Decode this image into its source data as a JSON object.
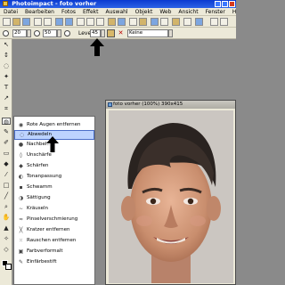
{
  "window": {
    "title": "Photoimpact - foto vorher",
    "controls": [
      "minimize-icon",
      "maximize-icon",
      "close-icon"
    ]
  },
  "menubar": {
    "items": [
      "Datei",
      "Bearbeiten",
      "Fotos",
      "Effekt",
      "Auswahl",
      "Objekt",
      "Web",
      "Ansicht",
      "Fenster",
      "Hilfe"
    ]
  },
  "options_bar": {
    "field1": "20",
    "field2": "50",
    "level_label": "Level",
    "level_value": "45",
    "mode_value": "Keine"
  },
  "flyout": {
    "items": [
      {
        "label": "Rote Augen entfernen",
        "icon": "eye-icon",
        "selected": false
      },
      {
        "label": "Abwedeln",
        "icon": "dodge-icon",
        "selected": true
      },
      {
        "label": "Nachbel...",
        "icon": "burn-icon",
        "selected": false
      },
      {
        "label": "Unschärfe",
        "icon": "blur-icon",
        "selected": false
      },
      {
        "label": "Schärfen",
        "icon": "sharpen-icon",
        "selected": false
      },
      {
        "label": "Tonanpassung",
        "icon": "tone-icon",
        "selected": false
      },
      {
        "label": "Schwamm",
        "icon": "sponge-icon",
        "selected": false
      },
      {
        "label": "Sättigung",
        "icon": "saturation-icon",
        "selected": false
      },
      {
        "label": "Kräuseln",
        "icon": "smudge-icon",
        "selected": false
      },
      {
        "label": "Pinselverschmierung",
        "icon": "brush-smear-icon",
        "selected": false
      },
      {
        "label": "Kratzer entfernen",
        "icon": "scratch-icon",
        "selected": false
      },
      {
        "label": "Rauschen entfernen",
        "icon": "noise-icon",
        "selected": false
      },
      {
        "label": "Farbverformalt",
        "icon": "color-icon",
        "selected": false
      },
      {
        "label": "Einfärbestift",
        "icon": "colorize-icon",
        "selected": false
      }
    ]
  },
  "image_window": {
    "title": "foto vorher (100%) 390x415"
  },
  "colors": {
    "title_bar": "#0a3ad0",
    "menu_bg": "#ece9d8",
    "selection": "#bcd3ff",
    "workspace": "#8a8a8a"
  }
}
